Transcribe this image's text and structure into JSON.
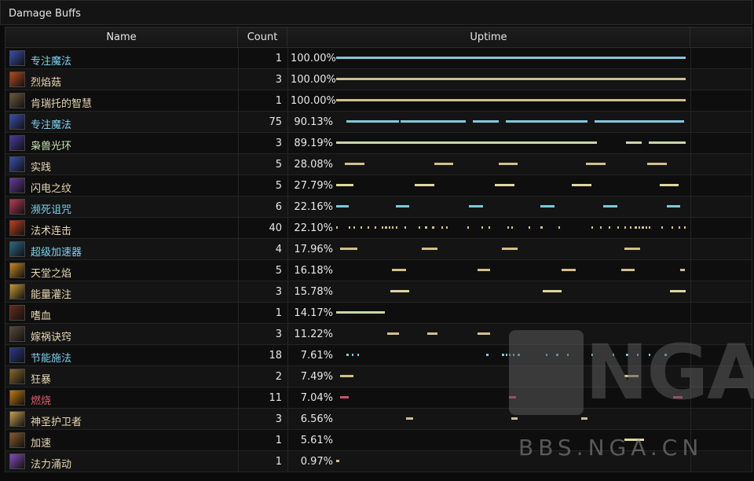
{
  "panel": {
    "title": "Damage Buffs"
  },
  "headers": {
    "name": "Name",
    "count": "Count",
    "uptime": "Uptime"
  },
  "colors": {
    "blue": "#7fc8dc",
    "tan": "#d2bf8c",
    "green": "#c8d6a4",
    "red": "#d24f6a"
  },
  "rows": [
    {
      "name": "专注魔法",
      "count": "1",
      "uptime": "100.00%",
      "name_color": "#7fd2f0",
      "icon": "arcane-swirl-icon",
      "bar_color": "#7fc8dc",
      "segments": [
        [
          0,
          1
        ]
      ]
    },
    {
      "name": "烈焰菇",
      "count": "3",
      "uptime": "100.00%",
      "name_color": "#e8d6b0",
      "icon": "fire-mushroom-icon",
      "bar_color": "#d2bf8c",
      "segments": [
        [
          0,
          1
        ]
      ]
    },
    {
      "name": "肯瑞托的智慧",
      "count": "1",
      "uptime": "100.00%",
      "name_color": "#e8d6b0",
      "icon": "kirin-tor-icon",
      "bar_color": "#d2bf8c",
      "segments": [
        [
          0,
          1
        ]
      ]
    },
    {
      "name": "专注魔法",
      "count": "75",
      "uptime": "90.13%",
      "name_color": "#7fd2f0",
      "icon": "arcane-swirl-icon",
      "bar_color": "#7fc8dc",
      "segments": [
        [
          0.03,
          0.18
        ],
        [
          0.185,
          0.37
        ],
        [
          0.39,
          0.465
        ],
        [
          0.485,
          0.72
        ],
        [
          0.74,
          0.995
        ]
      ]
    },
    {
      "name": "枭兽光环",
      "count": "3",
      "uptime": "89.19%",
      "name_color": "#c9e6b0",
      "icon": "moonkin-aura-icon",
      "bar_color": "#c8d6a4",
      "segments": [
        [
          0,
          0.745
        ],
        [
          0.83,
          0.875
        ],
        [
          0.895,
          1
        ]
      ]
    },
    {
      "name": "实践",
      "count": "5",
      "uptime": "28.08%",
      "name_color": "#e8d6b0",
      "icon": "practice-icon",
      "bar_color": "#d2bf8c",
      "segments": [
        [
          0.025,
          0.08
        ],
        [
          0.28,
          0.335
        ],
        [
          0.465,
          0.52
        ],
        [
          0.715,
          0.77
        ],
        [
          0.89,
          0.945
        ]
      ]
    },
    {
      "name": "闪电之纹",
      "count": "5",
      "uptime": "27.79%",
      "name_color": "#e8d6b0",
      "icon": "lightweave-icon",
      "bar_color": "#e0d6a0",
      "segments": [
        [
          0,
          0.05
        ],
        [
          0.225,
          0.28
        ],
        [
          0.455,
          0.51
        ],
        [
          0.675,
          0.73
        ],
        [
          0.925,
          0.98
        ]
      ]
    },
    {
      "name": "濒死诅咒",
      "count": "6",
      "uptime": "22.16%",
      "name_color": "#7fd2f0",
      "icon": "dying-curse-icon",
      "bar_color": "#7fc8dc",
      "segments": [
        [
          0,
          0.035
        ],
        [
          0.17,
          0.21
        ],
        [
          0.38,
          0.42
        ],
        [
          0.585,
          0.625
        ],
        [
          0.765,
          0.805
        ],
        [
          0.945,
          0.985
        ]
      ]
    },
    {
      "name": "法术连击",
      "count": "40",
      "uptime": "22.10%",
      "name_color": "#e8d6b0",
      "icon": "spell-combo-icon",
      "bar_color": "#d2bf8c",
      "segments": [
        [
          0,
          0.005
        ],
        [
          0.035,
          0.04
        ],
        [
          0.05,
          0.055
        ],
        [
          0.07,
          0.075
        ],
        [
          0.09,
          0.095
        ],
        [
          0.11,
          0.115
        ],
        [
          0.13,
          0.135
        ],
        [
          0.14,
          0.145
        ],
        [
          0.15,
          0.155
        ],
        [
          0.16,
          0.165
        ],
        [
          0.17,
          0.175
        ],
        [
          0.195,
          0.2
        ],
        [
          0.235,
          0.24
        ],
        [
          0.255,
          0.26
        ],
        [
          0.275,
          0.28
        ],
        [
          0.3,
          0.305
        ],
        [
          0.315,
          0.32
        ],
        [
          0.375,
          0.38
        ],
        [
          0.415,
          0.42
        ],
        [
          0.435,
          0.44
        ],
        [
          0.49,
          0.495
        ],
        [
          0.5,
          0.505
        ],
        [
          0.55,
          0.555
        ],
        [
          0.585,
          0.59
        ],
        [
          0.635,
          0.64
        ],
        [
          0.73,
          0.735
        ],
        [
          0.755,
          0.76
        ],
        [
          0.78,
          0.785
        ],
        [
          0.805,
          0.81
        ],
        [
          0.825,
          0.83
        ],
        [
          0.84,
          0.845
        ],
        [
          0.855,
          0.86
        ],
        [
          0.865,
          0.87
        ],
        [
          0.875,
          0.88
        ],
        [
          0.885,
          0.89
        ],
        [
          0.895,
          0.9
        ],
        [
          0.93,
          0.935
        ],
        [
          0.96,
          0.965
        ],
        [
          0.98,
          0.985
        ],
        [
          0.995,
          1
        ]
      ]
    },
    {
      "name": "超级加速器",
      "count": "4",
      "uptime": "17.96%",
      "name_color": "#7fd2f0",
      "icon": "hyperspeed-icon",
      "bar_color": "#d2bf8c",
      "segments": [
        [
          0.012,
          0.06
        ],
        [
          0.245,
          0.29
        ],
        [
          0.475,
          0.52
        ],
        [
          0.825,
          0.87
        ]
      ]
    },
    {
      "name": "天堂之焰",
      "count": "5",
      "uptime": "16.18%",
      "name_color": "#e8d6b0",
      "icon": "heaven-flame-icon",
      "bar_color": "#d2bf8c",
      "segments": [
        [
          0.16,
          0.2
        ],
        [
          0.405,
          0.44
        ],
        [
          0.645,
          0.685
        ],
        [
          0.815,
          0.855
        ],
        [
          0.985,
          0.997
        ]
      ]
    },
    {
      "name": "能量灌注",
      "count": "3",
      "uptime": "15.78%",
      "name_color": "#e8d6b0",
      "icon": "power-infusion-icon",
      "bar_color": "#e0d6a0",
      "segments": [
        [
          0.155,
          0.21
        ],
        [
          0.59,
          0.645
        ],
        [
          0.955,
          1
        ]
      ]
    },
    {
      "name": "嗜血",
      "count": "1",
      "uptime": "14.17%",
      "name_color": "#e8d6b0",
      "icon": "bloodlust-icon",
      "bar_color": "#c8d6a4",
      "segments": [
        [
          0,
          0.14
        ]
      ]
    },
    {
      "name": "嫁祸诀窍",
      "count": "3",
      "uptime": "11.22%",
      "name_color": "#e8d6b0",
      "icon": "tricks-of-trade-icon",
      "bar_color": "#d2bf8c",
      "segments": [
        [
          0.145,
          0.18
        ],
        [
          0.26,
          0.29
        ],
        [
          0.405,
          0.44
        ]
      ]
    },
    {
      "name": "节能施法",
      "count": "18",
      "uptime": "7.61%",
      "name_color": "#7fd2f0",
      "icon": "clearcasting-icon",
      "bar_color": "#7fc8dc",
      "segments": [
        [
          0.03,
          0.035
        ],
        [
          0.045,
          0.05
        ],
        [
          0.06,
          0.065
        ],
        [
          0.43,
          0.435
        ],
        [
          0.475,
          0.48
        ],
        [
          0.485,
          0.49
        ],
        [
          0.495,
          0.5
        ],
        [
          0.505,
          0.51
        ],
        [
          0.52,
          0.525
        ],
        [
          0.6,
          0.605
        ],
        [
          0.63,
          0.635
        ],
        [
          0.66,
          0.665
        ],
        [
          0.73,
          0.735
        ],
        [
          0.79,
          0.795
        ],
        [
          0.83,
          0.835
        ],
        [
          0.86,
          0.865
        ],
        [
          0.895,
          0.9
        ],
        [
          0.94,
          0.945
        ]
      ]
    },
    {
      "name": "狂暴",
      "count": "2",
      "uptime": "7.49%",
      "name_color": "#e8d6b0",
      "icon": "berserk-icon",
      "bar_color": "#d2bf8c",
      "segments": [
        [
          0.012,
          0.05
        ],
        [
          0.825,
          0.865
        ]
      ]
    },
    {
      "name": "燃烧",
      "count": "11",
      "uptime": "7.04%",
      "name_color": "#e05a6e",
      "icon": "combustion-icon",
      "bar_color": "#d24f6a",
      "segments": [
        [
          0.012,
          0.035
        ],
        [
          0.495,
          0.515
        ],
        [
          0.965,
          0.99
        ]
      ]
    },
    {
      "name": "神圣护卫者",
      "count": "3",
      "uptime": "6.56%",
      "name_color": "#e8d6b0",
      "icon": "divine-guardian-icon",
      "bar_color": "#d2bf8c",
      "segments": [
        [
          0.2,
          0.22
        ],
        [
          0.5,
          0.52
        ],
        [
          0.7,
          0.72
        ]
      ]
    },
    {
      "name": "加速",
      "count": "1",
      "uptime": "5.61%",
      "name_color": "#e8d6b0",
      "icon": "haste-icon",
      "bar_color": "#e0d6a0",
      "segments": [
        [
          0.825,
          0.88
        ]
      ]
    },
    {
      "name": "法力涌动",
      "count": "1",
      "uptime": "0.97%",
      "name_color": "#e8d6b0",
      "icon": "mana-surge-icon",
      "bar_color": "#d2bf8c",
      "segments": [
        [
          0,
          0.01
        ]
      ]
    }
  ],
  "watermark": {
    "logo": "NGA",
    "site": "BBS.NGA.CN"
  }
}
